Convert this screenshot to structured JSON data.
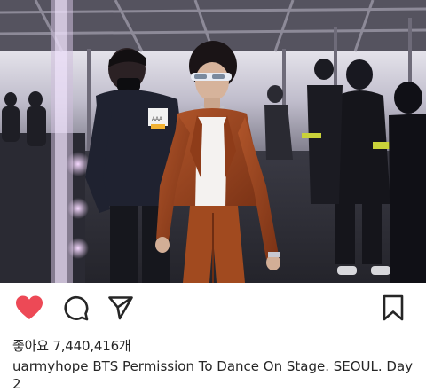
{
  "post": {
    "photo_alt": "photo",
    "likes_label": "좋아요",
    "likes_count": "7,440,416개",
    "username": "uarmyhope",
    "caption": "BTS Permission To Dance On Stage. SEOUL. Day 2",
    "badge_text": "AAA"
  },
  "actions": {
    "like_icon": "heart-filled-icon",
    "comment_icon": "comment-bubble-icon",
    "share_icon": "paper-plane-icon",
    "save_icon": "bookmark-icon"
  },
  "colors": {
    "heart": "#ED4956",
    "text": "#262626",
    "icon": "#262626"
  }
}
